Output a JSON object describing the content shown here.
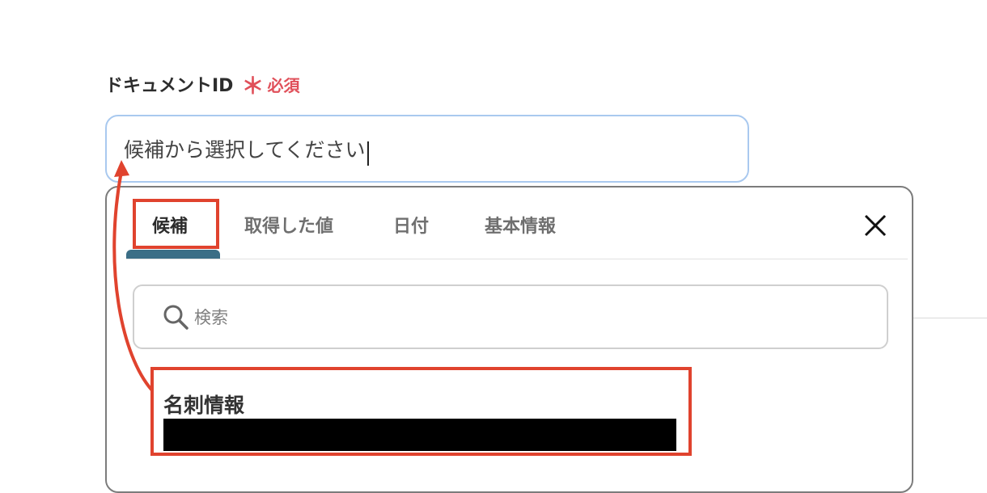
{
  "field": {
    "label": "ドキュメントID",
    "required_mark": "＊",
    "required_text": "必須",
    "input_placeholder": "候補から選択してください"
  },
  "popover": {
    "tabs": [
      {
        "label": "候補",
        "active": true
      },
      {
        "label": "取得した値",
        "active": false
      },
      {
        "label": "日付",
        "active": false
      },
      {
        "label": "基本情報",
        "active": false
      }
    ],
    "close_icon": "close-icon",
    "search": {
      "placeholder": "検索",
      "icon": "search-icon"
    },
    "candidates": [
      {
        "title": "名刺情報",
        "subtitle": "[redacted]"
      }
    ]
  },
  "annotation": {
    "highlight_color": "#e0432e",
    "arrow": "from candidate to input field"
  },
  "colors": {
    "required": "#e0505a",
    "input_border": "#a9c9ef",
    "tab_indicator": "#3b6e86"
  }
}
